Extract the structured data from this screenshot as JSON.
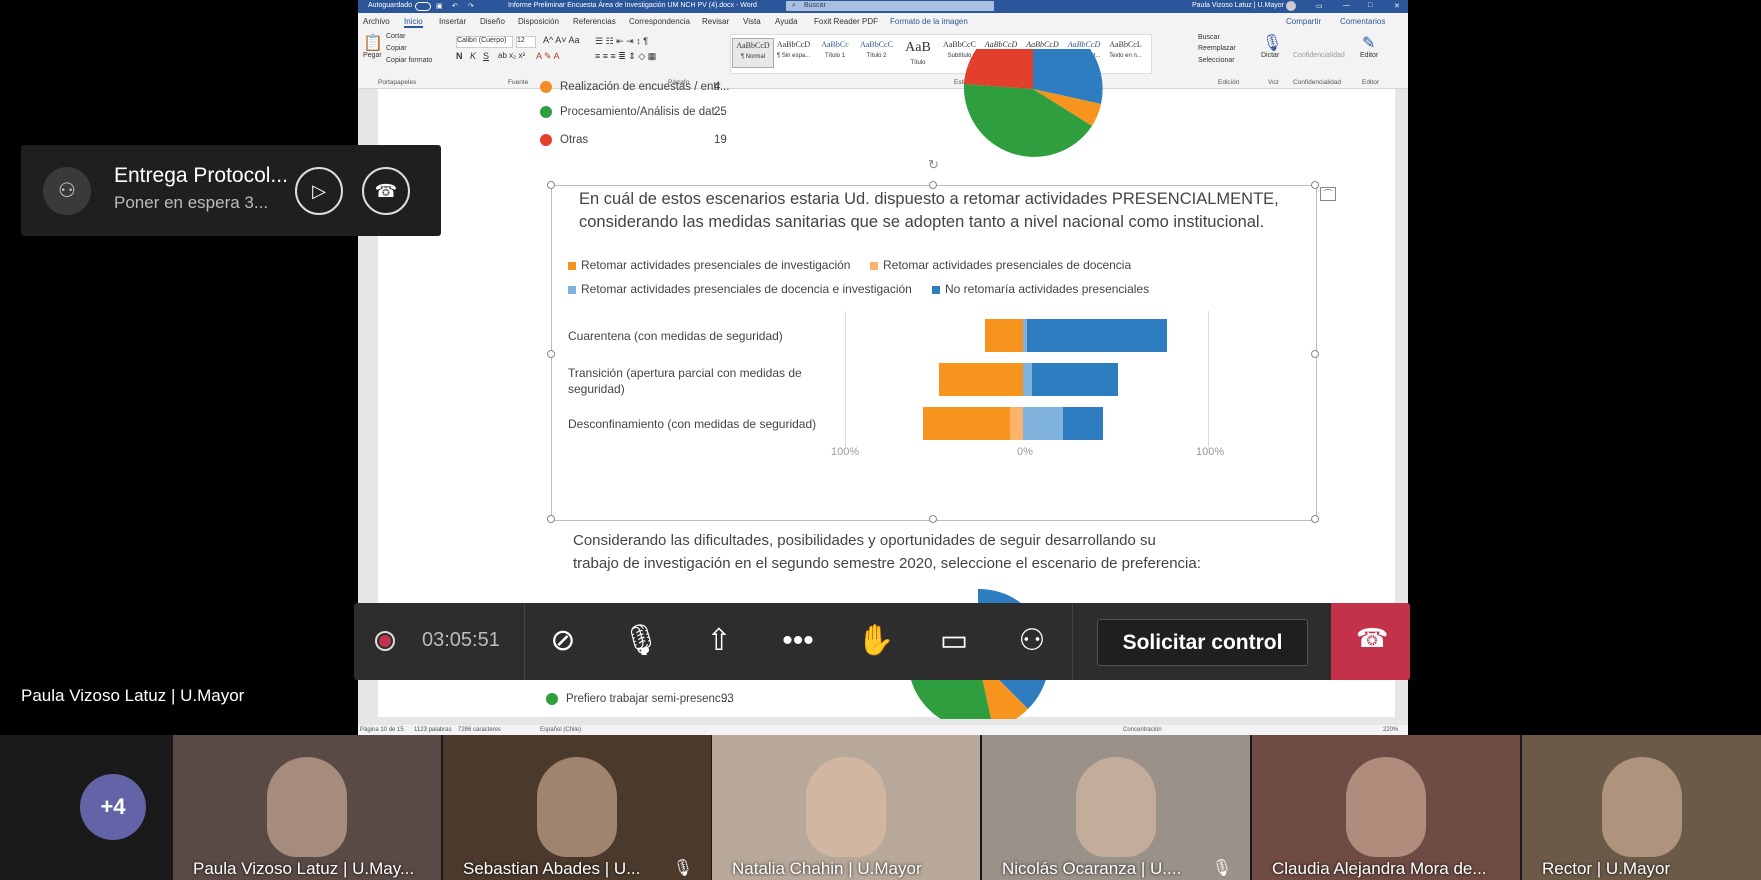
{
  "word": {
    "autosave_label": "Autoguardado",
    "document_title": "Informe Preliminar Encuesta Área de Investigación UM NCH PV (4).docx  -  Word",
    "search_placeholder": "Buscar",
    "user_name": "Paula Vizoso Latuz | U.Mayor",
    "tabs": [
      "Archivo",
      "Inicio",
      "Insertar",
      "Diseño",
      "Disposición",
      "Referencias",
      "Correspondencia",
      "Revisar",
      "Vista",
      "Ayuda",
      "Foxit Reader PDF",
      "Formato de la imagen"
    ],
    "share_label": "Compartir",
    "comments_label": "Comentarios",
    "clipboard": {
      "paste": "Pegar",
      "cut": "Cortar",
      "copy": "Copiar",
      "format_painter": "Copiar formato",
      "group": "Portapapeles"
    },
    "font": {
      "name": "Calibri (Cuerpo)",
      "size": "12",
      "group": "Fuente"
    },
    "paragraph_group": "Párrafo",
    "styles": [
      {
        "preview": "AaBbCcD",
        "name": "¶ Normal"
      },
      {
        "preview": "AaBbCcD",
        "name": "¶ Sin espa..."
      },
      {
        "preview": "AaBbCc",
        "name": "Título 1"
      },
      {
        "preview": "AaBbCcC",
        "name": "Título 2"
      },
      {
        "preview": "AaB",
        "name": "Título"
      },
      {
        "preview": "AaBbCcC",
        "name": "Subtítulo"
      },
      {
        "preview": "AaBbCcD",
        "name": "Énfasis sutil"
      },
      {
        "preview": "AaBbCcD",
        "name": "Énfasis"
      },
      {
        "preview": "AaBbCcD",
        "name": "Énfasis int..."
      },
      {
        "preview": "AaBbCcL",
        "name": "Texto en n..."
      }
    ],
    "styles_group": "Estilos",
    "editing": {
      "find": "Buscar",
      "replace": "Reemplazar",
      "select": "Seleccionar",
      "group": "Edición"
    },
    "voice": {
      "dictate": "Dictar",
      "group": "Voz"
    },
    "confidentiality": {
      "label": "Confidencialidad",
      "group": "Confidencialidad"
    },
    "editor": {
      "label": "Editor",
      "group": "Editor"
    },
    "status": {
      "page": "Página 10 de 15",
      "words": "1123 palabras",
      "chars": "7286 caracteres",
      "language": "Español (Chile)",
      "focus": "Concentración",
      "zoom": "220%"
    }
  },
  "doc": {
    "top_legend": [
      {
        "label": "Realización de encuestas / entr...",
        "value": "4",
        "color": "#f28c28"
      },
      {
        "label": "Procesamiento/Análisis de dat...",
        "value": "25",
        "color": "#2e9e3e"
      },
      {
        "label": "Otras",
        "value": "19",
        "color": "#e2402c"
      }
    ],
    "question1": "En cuál de estos escenarios estaria Ud. dispuesto a retomar actividades PRESENCIALMENTE, considerando las medidas sanitarias que se adopten tanto a nivel nacional como institucional.",
    "question2_line1": "Considerando las dificultades, posibilidades y oportunidades de seguir desarrollando su",
    "question2_line2": "trabajo de investigación en el segundo semestre 2020, seleccione el escenario de preferencia:",
    "bottom_legend": [
      {
        "label": "Prefiero trabajar semi-presenc...",
        "value": "93",
        "color": "#2e9e3e"
      }
    ]
  },
  "chart_data": {
    "type": "bar",
    "orientation": "horizontal-diverging",
    "categories": [
      "Cuarentena (con medidas de seguridad)",
      "Transición (apertura parcial con medidas de seguridad)",
      "Desconfinamiento (con medidas de seguridad)"
    ],
    "series": [
      {
        "name": "Retomar actividades presenciales de investigación",
        "color": "#f7941d",
        "side": "left",
        "values": [
          21,
          46,
          48
        ]
      },
      {
        "name": "Retomar actividades presenciales de docencia",
        "color": "#fbb36b",
        "side": "left",
        "values": [
          0,
          0,
          7
        ]
      },
      {
        "name": "Retomar actividades presenciales de docencia e investigación",
        "color": "#7fb2dc",
        "side": "right",
        "values": [
          2,
          5,
          22
        ]
      },
      {
        "name": "No retomaría actividades presenciales",
        "color": "#2f7dc1",
        "side": "right",
        "values": [
          77,
          47,
          22
        ]
      }
    ],
    "xticks": [
      "100%",
      "0%",
      "100%"
    ],
    "xlim": [
      -100,
      100
    ],
    "legend": "top"
  },
  "call": {
    "card_title": "Entrega Protocol...",
    "card_subtitle": "Poner en espera   3...",
    "timer": "03:05:51",
    "request_control": "Solicitar control",
    "presenter": "Paula Vizoso Latuz | U.Mayor",
    "more_count": "+4",
    "participants": [
      {
        "name": "Paula Vizoso Latuz | U.May...",
        "bg": "#5a4a46"
      },
      {
        "name": "Sebastian Abades | U...",
        "bg": "#4b3a2c"
      },
      {
        "name": "Natalia Chahin | U.Mayor",
        "bg": "#b8a89a"
      },
      {
        "name": "Nicolás Ocaranza | U....",
        "bg": "#9a9288"
      },
      {
        "name": "Claudia Alejandra Mora de...",
        "bg": "#6e4b43"
      },
      {
        "name": "Rector | U.Mayor",
        "bg": "#6c5a48"
      }
    ]
  }
}
